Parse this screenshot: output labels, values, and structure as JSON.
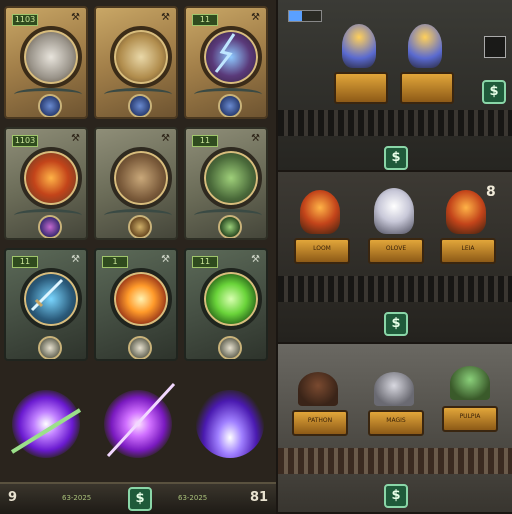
{
  "cards": [
    {
      "badge": "1103",
      "symbol": "⚒"
    },
    {
      "badge": "",
      "symbol": "⚒"
    },
    {
      "badge": "11",
      "symbol": "⚒"
    },
    {
      "badge": "1103",
      "symbol": "⚒"
    },
    {
      "badge": "",
      "symbol": "⚒"
    },
    {
      "badge": "11",
      "symbol": "⚒"
    },
    {
      "badge": "11",
      "symbol": "⚒"
    },
    {
      "badge": "1",
      "symbol": "⚒"
    },
    {
      "badge": "11",
      "symbol": "⚒"
    }
  ],
  "bottom_bar": {
    "left_number": "9",
    "right_number": "81",
    "left_label": "63-2025",
    "right_label": "63-2025",
    "currency_symbol": "$"
  },
  "panel1": {
    "currency_symbol": "$",
    "corner_currency": "$"
  },
  "panel2": {
    "counter": "8",
    "currency_symbol": "$",
    "pedestal_labels": [
      "LOOM",
      "OLOVE",
      "LEIA"
    ]
  },
  "panel3": {
    "currency_symbol": "$",
    "pedestal_labels": [
      "PATHON",
      "MAGIS",
      "PULPIA"
    ]
  },
  "colors": {
    "gold_card": "#c9a766",
    "stone_card": "#8f8e78",
    "green_card": "#5c6a58",
    "currency_green": "#1f5a3a",
    "pedestal_gold": "#e2a63a"
  }
}
